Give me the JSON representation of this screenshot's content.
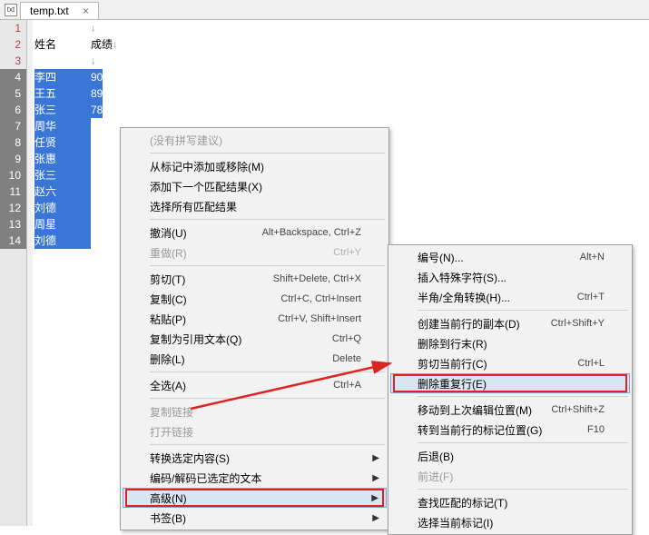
{
  "tab": {
    "title": "temp.txt",
    "close": "×",
    "icon": "txt"
  },
  "lines": [
    {
      "n": "1",
      "name": "",
      "score": "",
      "arrow": true
    },
    {
      "n": "2",
      "name": "姓名",
      "score": "成绩",
      "arrow": true,
      "header": true
    },
    {
      "n": "3",
      "name": "",
      "score": "",
      "arrow": true
    },
    {
      "n": "4",
      "name": "李四",
      "score": "90",
      "selected": true
    },
    {
      "n": "5",
      "name": "王五",
      "score": "89",
      "selected": true
    },
    {
      "n": "6",
      "name": "张三",
      "score": "78",
      "selected": true
    },
    {
      "n": "7",
      "name": "周华",
      "score": "",
      "selected": true
    },
    {
      "n": "8",
      "name": "任贤",
      "score": "",
      "selected": true
    },
    {
      "n": "9",
      "name": "张惠",
      "score": "",
      "selected": true
    },
    {
      "n": "10",
      "name": "张三",
      "score": "",
      "selected": true
    },
    {
      "n": "11",
      "name": "赵六",
      "score": "",
      "selected": true
    },
    {
      "n": "12",
      "name": "刘德",
      "score": "",
      "selected": true
    },
    {
      "n": "13",
      "name": "周星",
      "score": "",
      "selected": true
    },
    {
      "n": "14",
      "name": "刘德",
      "score": "",
      "selected": true
    }
  ],
  "mainMenu": [
    {
      "label": "(没有拼写建议)",
      "disabled": true
    },
    {
      "sep": true
    },
    {
      "label": "从标记中添加或移除(M)"
    },
    {
      "label": "添加下一个匹配结果(X)"
    },
    {
      "label": "选择所有匹配结果"
    },
    {
      "sep": true
    },
    {
      "label": "撤消(U)",
      "shortcut": "Alt+Backspace, Ctrl+Z"
    },
    {
      "label": "重做(R)",
      "shortcut": "Ctrl+Y",
      "disabled": true
    },
    {
      "sep": true
    },
    {
      "label": "剪切(T)",
      "shortcut": "Shift+Delete, Ctrl+X"
    },
    {
      "label": "复制(C)",
      "shortcut": "Ctrl+C, Ctrl+Insert"
    },
    {
      "label": "粘贴(P)",
      "shortcut": "Ctrl+V, Shift+Insert"
    },
    {
      "label": "复制为引用文本(Q)",
      "shortcut": "Ctrl+Q"
    },
    {
      "label": "删除(L)",
      "shortcut": "Delete"
    },
    {
      "sep": true
    },
    {
      "label": "全选(A)",
      "shortcut": "Ctrl+A"
    },
    {
      "sep": true
    },
    {
      "label": "复制链接",
      "disabled": true
    },
    {
      "label": "打开链接",
      "disabled": true
    },
    {
      "sep": true
    },
    {
      "label": "转换选定内容(S)",
      "submenu": true
    },
    {
      "label": "编码/解码已选定的文本",
      "submenu": true
    },
    {
      "label": "高级(N)",
      "submenu": true,
      "highlighted": true,
      "boxed": true
    },
    {
      "label": "书签(B)",
      "submenu": true
    }
  ],
  "subMenu": [
    {
      "label": "编号(N)...",
      "shortcut": "Alt+N"
    },
    {
      "label": "插入特殊字符(S)..."
    },
    {
      "label": "半角/全角转换(H)...",
      "shortcut": "Ctrl+T"
    },
    {
      "sep": true
    },
    {
      "label": "创建当前行的副本(D)",
      "shortcut": "Ctrl+Shift+Y"
    },
    {
      "label": "删除到行末(R)"
    },
    {
      "label": "剪切当前行(C)",
      "shortcut": "Ctrl+L"
    },
    {
      "label": "删除重复行(E)",
      "highlighted": true,
      "boxed": true
    },
    {
      "sep": true
    },
    {
      "label": "移动到上次编辑位置(M)",
      "shortcut": "Ctrl+Shift+Z"
    },
    {
      "label": "转到当前行的标记位置(G)",
      "shortcut": "F10"
    },
    {
      "sep": true
    },
    {
      "label": "后退(B)"
    },
    {
      "label": "前进(F)",
      "disabled": true
    },
    {
      "sep": true
    },
    {
      "label": "查找匹配的标记(T)"
    },
    {
      "label": "选择当前标记(I)"
    }
  ]
}
